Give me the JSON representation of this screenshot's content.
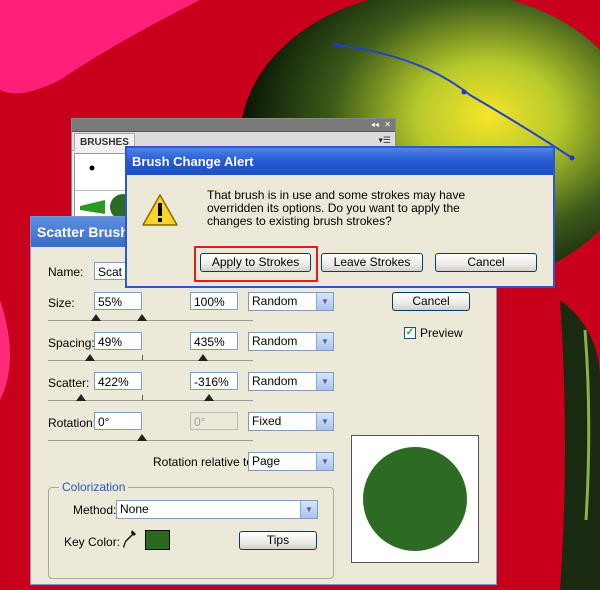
{
  "brushes_panel": {
    "title": "BRUSHES",
    "collapse_icon": "double-chevron",
    "close_icon": "close"
  },
  "scatter_dialog": {
    "title": "Scatter Brush",
    "name_label": "Name:",
    "name_value": "Scat",
    "size_label": "Size:",
    "size_min": "55%",
    "size_max": "100%",
    "size_mode": "Random",
    "spacing_label": "Spacing:",
    "spacing_min": "49%",
    "spacing_max": "435%",
    "spacing_mode": "Random",
    "scatter_label": "Scatter:",
    "scatter_min": "422%",
    "scatter_max": "-316%",
    "scatter_mode": "Random",
    "rotation_label": "Rotation:",
    "rotation_min": "0°",
    "rotation_max": "0°",
    "rotation_mode": "Fixed",
    "rotation_relative_label": "Rotation relative to:",
    "rotation_relative_value": "Page",
    "cancel_label": "Cancel",
    "preview_label": "Preview",
    "preview_checked": true,
    "colorization_legend": "Colorization",
    "method_label": "Method:",
    "method_value": "None",
    "key_color_label": "Key Color:",
    "key_color": "#2a6a1f",
    "tips_label": "Tips",
    "preview_color": "#2d6a24"
  },
  "alert": {
    "title": "Brush Change Alert",
    "message": "That brush is in use and some strokes may have overridden its options.  Do you want to apply the changes to existing brush strokes?",
    "apply_label": "Apply to Strokes",
    "leave_label": "Leave Strokes",
    "cancel_label": "Cancel"
  }
}
